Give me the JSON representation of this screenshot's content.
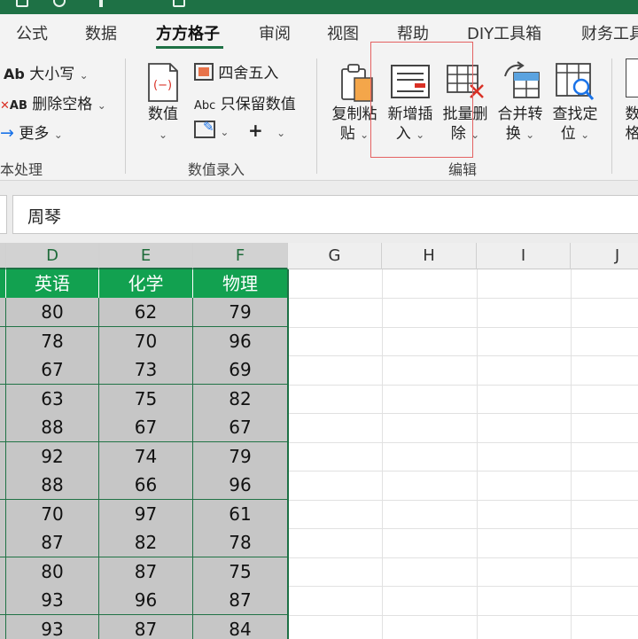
{
  "ribbon_tabs": [
    "公式",
    "数据",
    "方方格子",
    "审阅",
    "视图",
    "帮助",
    "DIY工具箱",
    "财务工具"
  ],
  "active_tab": "方方格子",
  "text_group": {
    "case_label": "大小写",
    "case_prefix": "Ab",
    "delete_spaces_label": "删除空格",
    "delete_prefix": "AB",
    "more_label": "更多",
    "group_label": "本处理"
  },
  "numeric_group": {
    "value_label_line1": "数值",
    "round_label": "四舍五入",
    "keep_numeric_label": "只保留数值",
    "abc_prefix": "Abc",
    "plus_glyph": "+",
    "group_label": "数值录入"
  },
  "edit_group": {
    "copy_paste_line1": "复制粘",
    "copy_paste_line2": "贴",
    "insert_line1": "新增插",
    "insert_line2": "入",
    "batch_delete_line1": "批量删",
    "batch_delete_line2": "除",
    "merge_convert_line1": "合并转",
    "merge_convert_line2": "换",
    "find_locate_line1": "查找定",
    "find_locate_line2": "位",
    "group_label": "编辑"
  },
  "partial_button": {
    "line1": "数",
    "line2": "格"
  },
  "formula_bar": {
    "value": "周琴"
  },
  "column_headers": [
    "D",
    "E",
    "F",
    "G",
    "H",
    "I",
    "J"
  ],
  "table": {
    "headers": [
      "英语",
      "化学",
      "物理"
    ],
    "rows": [
      [
        "80",
        "62",
        "79"
      ],
      [
        "78",
        "70",
        "96"
      ],
      [
        "67",
        "73",
        "69"
      ],
      [
        "63",
        "75",
        "82"
      ],
      [
        "88",
        "67",
        "67"
      ],
      [
        "92",
        "74",
        "79"
      ],
      [
        "88",
        "66",
        "96"
      ],
      [
        "70",
        "97",
        "61"
      ],
      [
        "87",
        "82",
        "78"
      ],
      [
        "80",
        "87",
        "75"
      ],
      [
        "93",
        "96",
        "87"
      ],
      [
        "93",
        "87",
        "84"
      ]
    ]
  },
  "colors": {
    "accent": "#1e7145",
    "header_fill": "#12a150",
    "selection_fill": "#c6c6c6",
    "highlight_box": "#e46262"
  }
}
